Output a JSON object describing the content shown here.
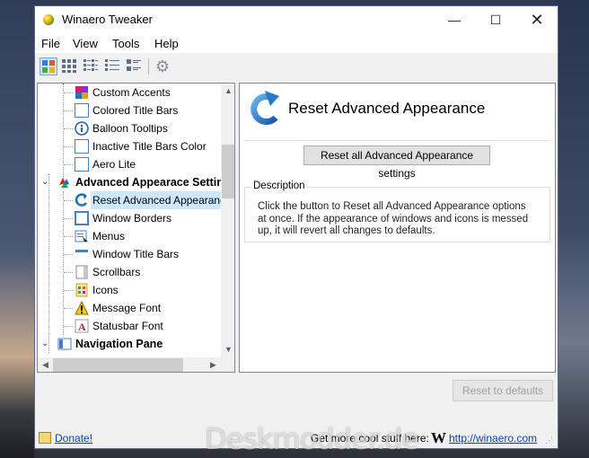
{
  "window": {
    "title": "Winaero Tweaker",
    "controls": {
      "minimize": "—",
      "maximize": "☐",
      "close": "✕"
    }
  },
  "menu": [
    "File",
    "View",
    "Tools",
    "Help"
  ],
  "toolbar": {
    "icons": [
      "view-large-icon",
      "view-grid-icon",
      "view-list-icon",
      "view-details-icon",
      "view-tiles-icon",
      "settings-gear-icon"
    ]
  },
  "tree": {
    "items": [
      {
        "label": "Custom Accents",
        "level": 2,
        "icon": "custom-accents-icon"
      },
      {
        "label": "Colored Title Bars",
        "level": 2,
        "icon": "window-icon"
      },
      {
        "label": "Balloon Tooltips",
        "level": 2,
        "icon": "info-icon"
      },
      {
        "label": "Inactive Title Bars Color",
        "level": 2,
        "icon": "window-icon"
      },
      {
        "label": "Aero Lite",
        "level": 2,
        "icon": "window-icon"
      },
      {
        "label": "Advanced Appearace Settin",
        "level": 1,
        "icon": "palette-icon",
        "expander": "⌄",
        "bold": true
      },
      {
        "label": "Reset Advanced Appearance",
        "level": 2,
        "icon": "reset-arrow-icon",
        "selected": true
      },
      {
        "label": "Window Borders",
        "level": 2,
        "icon": "window-border-icon"
      },
      {
        "label": "Menus",
        "level": 2,
        "icon": "menu-icon"
      },
      {
        "label": "Window Title Bars",
        "level": 2,
        "icon": "title-bar-icon"
      },
      {
        "label": "Scrollbars",
        "level": 2,
        "icon": "scrollbar-icon"
      },
      {
        "label": "Icons",
        "level": 2,
        "icon": "icons-icon"
      },
      {
        "label": "Message Font",
        "level": 2,
        "icon": "warning-icon"
      },
      {
        "label": "Statusbar Font",
        "level": 2,
        "icon": "font-icon"
      },
      {
        "label": "Navigation Pane",
        "level": 1,
        "icon": "navigation-pane-icon",
        "expander": "⌄",
        "bold": true
      }
    ]
  },
  "panel": {
    "title": "Reset Advanced Appearance",
    "reset_button": "Reset all Advanced Appearance settings",
    "description_legend": "Description",
    "description": "Click the button to Reset all Advanced Appearance options at once. If the appearance of windows and icons is messed up, it will revert all changes to defaults."
  },
  "reset_defaults_button": "Reset to defaults",
  "status": {
    "donate": "Donate!",
    "cool_stuff": "Get more cool stuff here:",
    "logo_letter": "W",
    "site": "http://winaero.com"
  },
  "watermark": "Deskmodder.de",
  "colors": {
    "selection": "#cce8ff",
    "link": "#0645ad",
    "accent_arrow": "#1e73be"
  }
}
